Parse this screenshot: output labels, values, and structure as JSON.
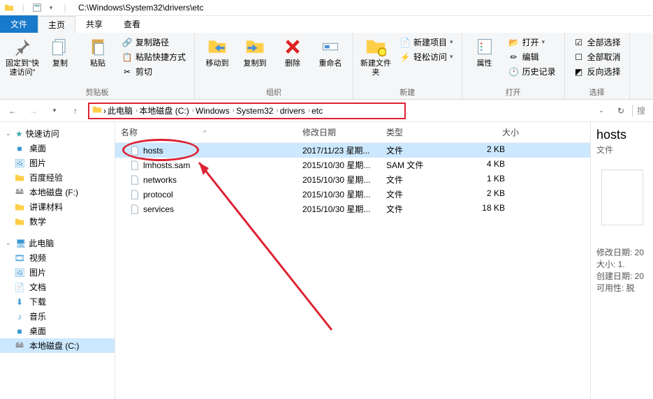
{
  "title_path": "C:\\Windows\\System32\\drivers\\etc",
  "tabs": {
    "file": "文件",
    "home": "主页",
    "share": "共享",
    "view": "查看"
  },
  "ribbon": {
    "pin": "固定到\"快速访问\"",
    "copy": "复制",
    "paste": "粘贴",
    "copypath": "复制路径",
    "pasteshortcut": "粘贴快捷方式",
    "cut": "剪切",
    "moveto": "移动到",
    "copyto": "复制到",
    "delete": "删除",
    "rename": "重命名",
    "newfolder": "新建文件夹",
    "newitem": "新建项目",
    "easyaccess": "轻松访问",
    "properties": "属性",
    "open": "打开",
    "edit": "编辑",
    "history": "历史记录",
    "selectall": "全部选择",
    "selectnone": "全部取消",
    "invert": "反向选择",
    "g_clip": "剪贴板",
    "g_org": "组织",
    "g_new": "新建",
    "g_open": "打开",
    "g_sel": "选择"
  },
  "breadcrumbs": [
    "此电脑",
    "本地磁盘 (C:)",
    "Windows",
    "System32",
    "drivers",
    "etc"
  ],
  "search_label": "搜",
  "columns": {
    "name": "名称",
    "date": "修改日期",
    "type": "类型",
    "size": "大小"
  },
  "files": [
    {
      "name": "hosts",
      "date": "2017/11/23 星期...",
      "type": "文件",
      "size": "2 KB",
      "sel": true
    },
    {
      "name": "lmhosts.sam",
      "date": "2015/10/30 星期...",
      "type": "SAM 文件",
      "size": "4 KB"
    },
    {
      "name": "networks",
      "date": "2015/10/30 星期...",
      "type": "文件",
      "size": "1 KB"
    },
    {
      "name": "protocol",
      "date": "2015/10/30 星期...",
      "type": "文件",
      "size": "2 KB"
    },
    {
      "name": "services",
      "date": "2015/10/30 星期...",
      "type": "文件",
      "size": "18 KB"
    }
  ],
  "sidebar": {
    "quick": "快速访问",
    "quick_items": [
      "桌面",
      "图片",
      "百度经验",
      "本地磁盘 (F:)",
      "讲课材料",
      "数学"
    ],
    "thispc": "此电脑",
    "pc_items": [
      "视频",
      "图片",
      "文档",
      "下载",
      "音乐",
      "桌面",
      "本地磁盘 (C:)"
    ]
  },
  "preview": {
    "title": "hosts",
    "subtitle": "文件",
    "meta": [
      "修改日期:  20",
      "大小:         1.",
      "创建日期:  20",
      "可用性:     脱"
    ]
  }
}
